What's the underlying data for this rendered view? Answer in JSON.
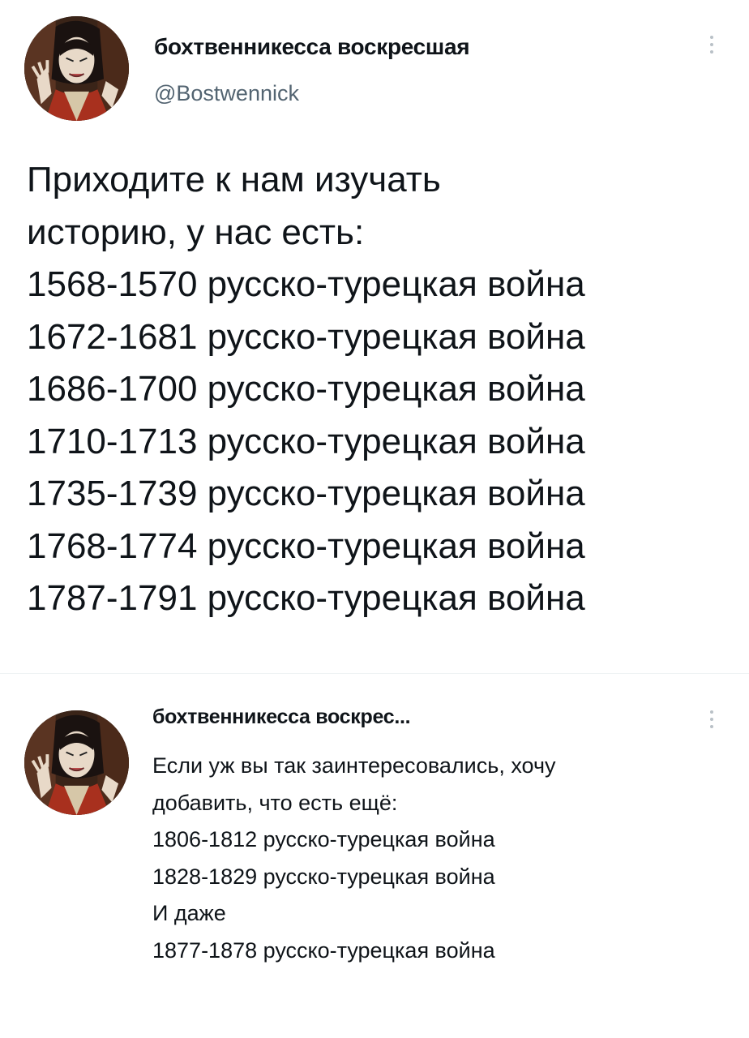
{
  "main_tweet": {
    "author": {
      "display_name": "бохтвенникесса воскресшая",
      "handle": "@Bostwennick",
      "avatar_icon": "avatar-anime-character"
    },
    "more_icon": "more-vertical-icon",
    "text_lines": [
      "Приходите к нам изучать",
      "историю, у нас есть:",
      "1568-1570 русско-турецкая война",
      "1672-1681 русско-турецкая война",
      "1686-1700 русско-турецкая война",
      "1710-1713 русско-турецкая война",
      "1735-1739 русско-турецкая война",
      "1768-1774 русско-турецкая война",
      "1787-1791 русско-турецкая война"
    ]
  },
  "reply_tweet": {
    "author": {
      "display_name": "бохтвенникесса воскрес...",
      "avatar_icon": "avatar-anime-character"
    },
    "more_icon": "more-vertical-icon",
    "text_lines": [
      "Если уж вы так заинтересовались, хочу",
      "добавить, что есть ещё:",
      "1806-1812 русско-турецкая война",
      "1828-1829 русско-турецкая война",
      "И даже",
      "1877-1878 русско-турецкая война"
    ]
  },
  "colors": {
    "text_primary": "#0f1419",
    "text_secondary": "#536471",
    "divider": "#eff3f4",
    "background": "#ffffff"
  }
}
